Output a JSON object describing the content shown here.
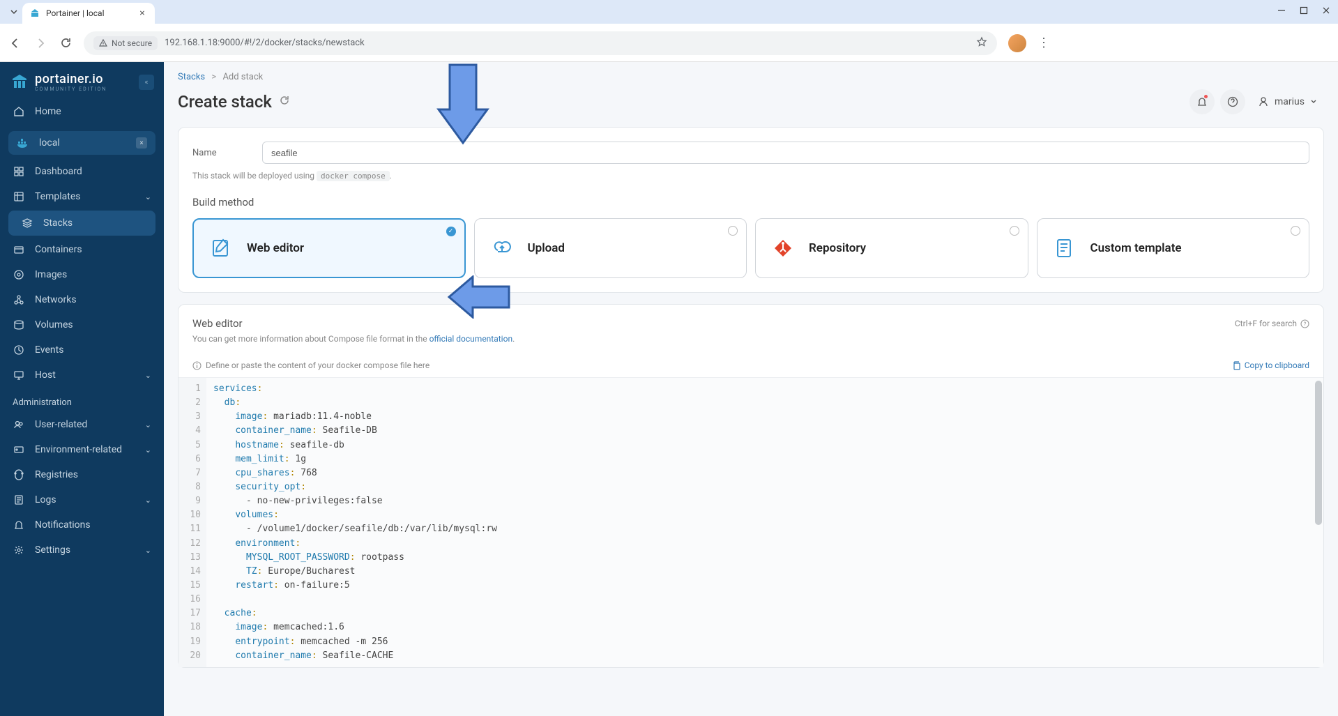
{
  "browser": {
    "tab_title": "Portainer | local",
    "url": "192.168.1.18:9000/#!/2/docker/stacks/newstack",
    "security_label": "Not secure"
  },
  "brand": {
    "title": "portainer.io",
    "subtitle": "COMMUNITY EDITION"
  },
  "nav": {
    "home": "Home",
    "env_name": "local",
    "items": [
      "Dashboard",
      "Templates",
      "Stacks",
      "Containers",
      "Images",
      "Networks",
      "Volumes",
      "Events",
      "Host"
    ],
    "admin_label": "Administration",
    "admin_items": [
      "User-related",
      "Environment-related",
      "Registries",
      "Logs",
      "Notifications",
      "Settings"
    ]
  },
  "breadcrumb": {
    "root": "Stacks",
    "current": "Add stack"
  },
  "page_title": "Create stack",
  "user_name": "marius",
  "form": {
    "name_label": "Name",
    "name_value": "seafile",
    "help_prefix": "This stack will be deployed using ",
    "help_code": "docker compose",
    "help_suffix": "."
  },
  "build": {
    "header": "Build method",
    "methods": [
      "Web editor",
      "Upload",
      "Repository",
      "Custom template"
    ]
  },
  "editor": {
    "title": "Web editor",
    "search_hint": "Ctrl+F for search",
    "desc_prefix": "You can get more information about Compose file format in the ",
    "desc_link": "official documentation",
    "desc_suffix": ".",
    "placeholder_hint": "Define or paste the content of your docker compose file here",
    "copy_label": "Copy to clipboard",
    "lines": [
      [
        [
          "key",
          "services"
        ],
        [
          "punc",
          ":"
        ]
      ],
      [
        [
          "val",
          "  "
        ],
        [
          "key",
          "db"
        ],
        [
          "punc",
          ":"
        ]
      ],
      [
        [
          "val",
          "    "
        ],
        [
          "key",
          "image"
        ],
        [
          "punc",
          ": "
        ],
        [
          "val",
          "mariadb:11.4-noble"
        ]
      ],
      [
        [
          "val",
          "    "
        ],
        [
          "key",
          "container_name"
        ],
        [
          "punc",
          ": "
        ],
        [
          "val",
          "Seafile-DB"
        ]
      ],
      [
        [
          "val",
          "    "
        ],
        [
          "key",
          "hostname"
        ],
        [
          "punc",
          ": "
        ],
        [
          "val",
          "seafile-db"
        ]
      ],
      [
        [
          "val",
          "    "
        ],
        [
          "key",
          "mem_limit"
        ],
        [
          "punc",
          ": "
        ],
        [
          "val",
          "1g"
        ]
      ],
      [
        [
          "val",
          "    "
        ],
        [
          "key",
          "cpu_shares"
        ],
        [
          "punc",
          ": "
        ],
        [
          "val",
          "768"
        ]
      ],
      [
        [
          "val",
          "    "
        ],
        [
          "key",
          "security_opt"
        ],
        [
          "punc",
          ":"
        ]
      ],
      [
        [
          "val",
          "      - no-new-privileges:false"
        ]
      ],
      [
        [
          "val",
          "    "
        ],
        [
          "key",
          "volumes"
        ],
        [
          "punc",
          ":"
        ]
      ],
      [
        [
          "val",
          "      - /volume1/docker/seafile/db:/var/lib/mysql:rw"
        ]
      ],
      [
        [
          "val",
          "    "
        ],
        [
          "key",
          "environment"
        ],
        [
          "punc",
          ":"
        ]
      ],
      [
        [
          "val",
          "      "
        ],
        [
          "key",
          "MYSQL_ROOT_PASSWORD"
        ],
        [
          "punc",
          ": "
        ],
        [
          "val",
          "rootpass"
        ]
      ],
      [
        [
          "val",
          "      "
        ],
        [
          "key",
          "TZ"
        ],
        [
          "punc",
          ": "
        ],
        [
          "val",
          "Europe/Bucharest"
        ]
      ],
      [
        [
          "val",
          "    "
        ],
        [
          "key",
          "restart"
        ],
        [
          "punc",
          ": "
        ],
        [
          "val",
          "on-failure:5"
        ]
      ],
      [
        [
          "val",
          ""
        ]
      ],
      [
        [
          "val",
          "  "
        ],
        [
          "key",
          "cache"
        ],
        [
          "punc",
          ":"
        ]
      ],
      [
        [
          "val",
          "    "
        ],
        [
          "key",
          "image"
        ],
        [
          "punc",
          ": "
        ],
        [
          "val",
          "memcached:1.6"
        ]
      ],
      [
        [
          "val",
          "    "
        ],
        [
          "key",
          "entrypoint"
        ],
        [
          "punc",
          ": "
        ],
        [
          "val",
          "memcached -m 256"
        ]
      ],
      [
        [
          "val",
          "    "
        ],
        [
          "key",
          "container_name"
        ],
        [
          "punc",
          ": "
        ],
        [
          "val",
          "Seafile-CACHE"
        ]
      ]
    ]
  }
}
